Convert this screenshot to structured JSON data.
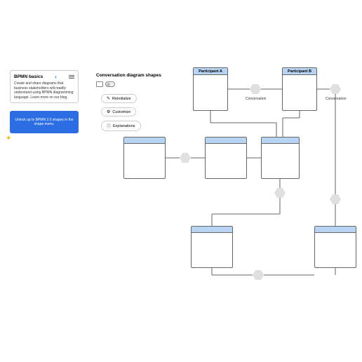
{
  "info": {
    "title": "BPMN basics",
    "body": "Create and share diagrams that business stakeholders will readily understand using BPMN diagramming language. Learn more on our blog."
  },
  "promo": {
    "text": "Unlock up to BPMN 2.0 shapes in the shape menu."
  },
  "shapes": {
    "title": "Conversation diagram shapes",
    "btn1": "Reinitialize",
    "btn2": "Customize",
    "btn3": "Explanations"
  },
  "participants": {
    "a": "Participant A",
    "b": "Participant B"
  },
  "labels": {
    "conv": "Conversation"
  }
}
